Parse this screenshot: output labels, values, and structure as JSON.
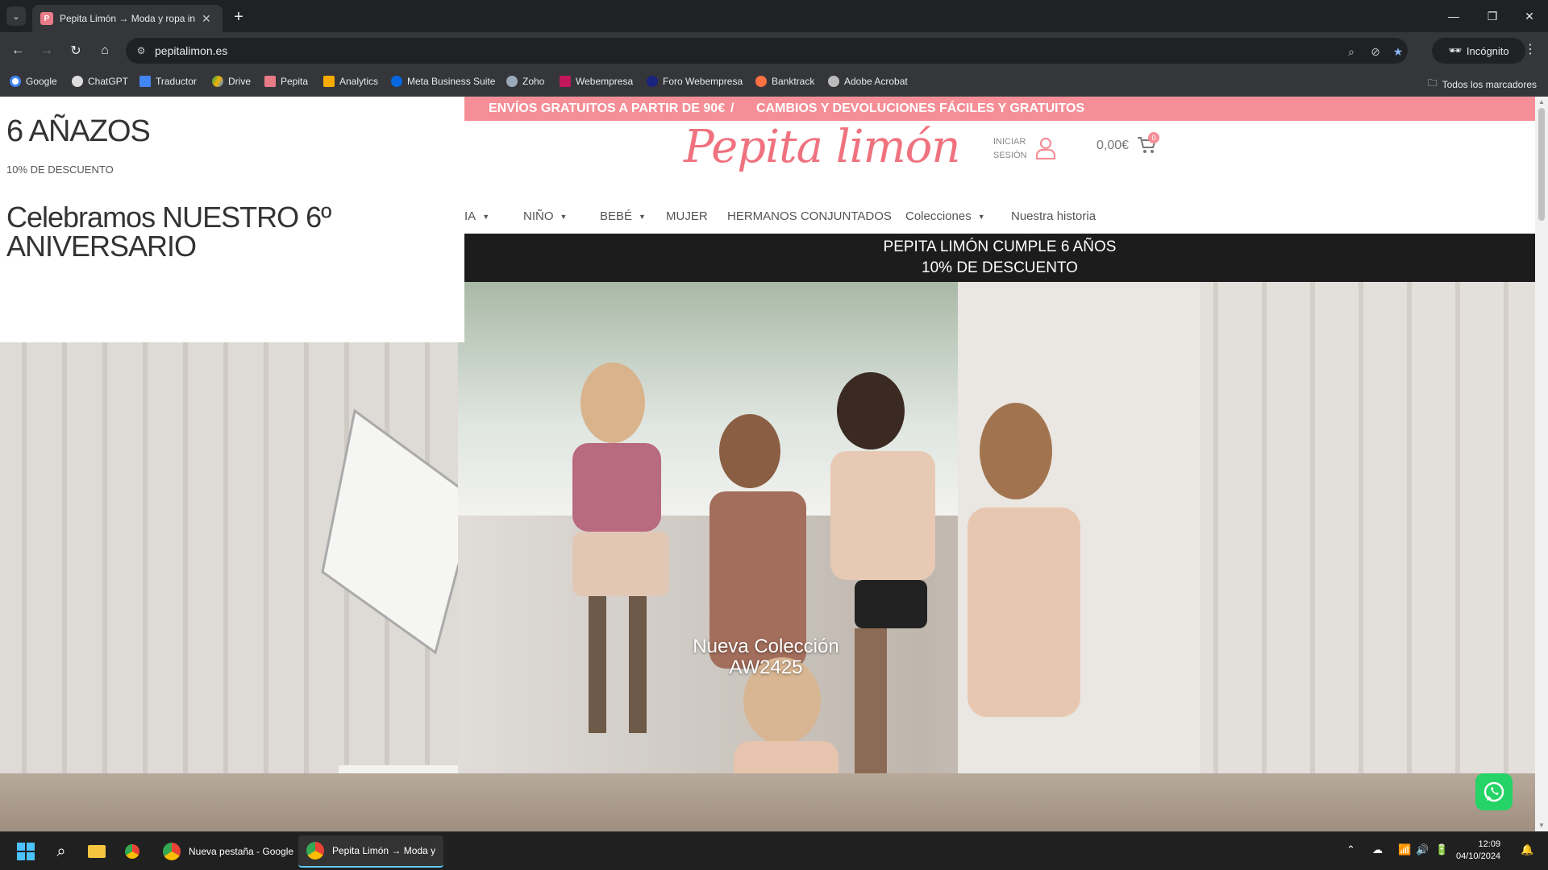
{
  "browser": {
    "tab_title": "Pepita Limón → Moda y ropa infantil",
    "tab_favicon": "P",
    "url": "pepitalimon.es",
    "incognito_label": "Incógnito",
    "bookmarks": [
      "Google",
      "ChatGPT",
      "Traductor",
      "Drive",
      "Pepita",
      "Analytics",
      "Meta Business Suite",
      "Zoho",
      "Webempresa",
      "Foro Webempresa",
      "Banktrack",
      "Adobe Acrobat"
    ],
    "all_bookmarks": "Todos los marcadores"
  },
  "site": {
    "promo_left": "ENVÍOS GRATUITOS A PARTIR DE 90€",
    "promo_sep": "/",
    "promo_right": "CAMBIOS Y DEVOLUCIONES FÁCILES Y GRATUITOS",
    "logo": "Pepita limón",
    "login_line1": "INICIAR",
    "login_line2": "SESIÓN",
    "cart_amount": "0,00€",
    "cart_count": "0",
    "nav": [
      "IA",
      "NIÑO",
      "BEBÉ",
      "MUJER",
      "HERMANOS CONJUNTADOS",
      "Colecciones",
      "Nuestra historia"
    ],
    "announce_line1": "PEPITA LIMÓN CUMPLE 6 AÑOS",
    "announce_line2": "10% DE DESCUENTO",
    "hero_line1": "Nueva Colección",
    "hero_line2": "AW2425",
    "colors": {
      "accent": "#f58e96",
      "logo": "#f0727f"
    }
  },
  "popup": {
    "title": "6 AÑAZOS",
    "subtitle": "10% DE DESCUENTO",
    "heading": "Celebramos NUESTRO 6º ANIVERSARIO"
  },
  "taskbar": {
    "apps": [
      "Nueva pestaña - Google",
      "Pepita Limón → Moda y"
    ],
    "time": "12:09",
    "date": "04/10/2024"
  }
}
